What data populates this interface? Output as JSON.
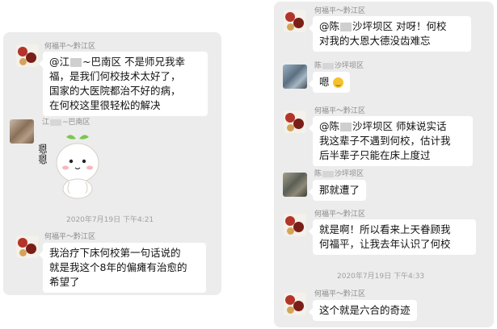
{
  "left_panel": {
    "messages": [
      {
        "sender": "何福平～黔江区",
        "lines": [
          "@江",
          "~巴南区 不是师兄我幸",
          "福，是我们何校技术太好了，",
          "国家的大医院都治不好的病，",
          "在何校这里很轻松的解决"
        ]
      },
      {
        "sender_prefix": "江",
        "sender_suffix": "~巴南区",
        "sticker_text": "嗯嗯"
      },
      {
        "timestamp": "2020年7月19日 下午4:21"
      },
      {
        "sender": "何福平～黔江区",
        "lines": [
          "我治疗下床何校第一句话说的",
          "就是我这个8年的偏瘫有治愈的",
          "希望了"
        ]
      }
    ]
  },
  "right_panel": {
    "messages": [
      {
        "sender": "何福平～黔江区",
        "lines": [
          "@陈",
          "沙坪坝区 对呀！何校",
          "对我的大恩大德没齿难忘"
        ]
      },
      {
        "sender_prefix": "陈",
        "sender_suffix": "沙坪坝区",
        "text": "嗯"
      },
      {
        "sender": "何福平～黔江区",
        "lines": [
          "@陈",
          "沙坪坝区 师妹说实话",
          "我这辈子不遇到何校，估计我",
          "后半辈子只能在床上度过"
        ]
      },
      {
        "sender_prefix": "陈",
        "sender_suffix": "沙坪坝区",
        "text": "那就遭了"
      },
      {
        "sender": "何福平～黔江区",
        "lines": [
          "就是啊！所以看来上天眷顾我",
          "何福平，让我去年认识了何校"
        ]
      },
      {
        "timestamp": "2020年7月19日 下午4:33"
      },
      {
        "sender": "何福平～黔江区",
        "text": "这个就是六合的奇迹"
      }
    ]
  },
  "colors": {
    "panel_bg": "#ececec",
    "bubble_bg": "#ffffff",
    "meta_text": "#8a8a8a"
  }
}
